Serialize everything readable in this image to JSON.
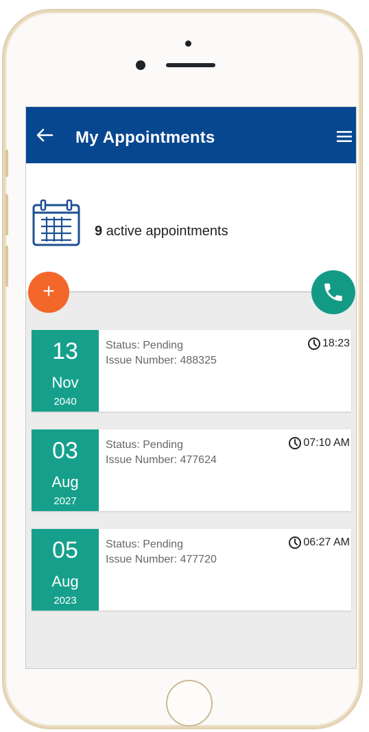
{
  "header": {
    "title": "My Appointments"
  },
  "summary": {
    "count": "9",
    "text": "active appointments"
  },
  "actions": {
    "add_label": "+"
  },
  "appointments": [
    {
      "day": "13",
      "month": "Nov",
      "year": "2040",
      "status": "Status: Pending",
      "issue": "Issue Number: 488325",
      "time": "18:23"
    },
    {
      "day": "03",
      "month": "Aug",
      "year": "2027",
      "status": "Status: Pending",
      "issue": "Issue Number: 477624",
      "time": "07:10 AM"
    },
    {
      "day": "05",
      "month": "Aug",
      "year": "2023",
      "status": "Status: Pending",
      "issue": "Issue Number: 477720",
      "time": "06:27 AM"
    }
  ],
  "icons": {
    "back": "arrow-left-icon",
    "menu": "hamburger-menu-icon",
    "calendar": "calendar-icon",
    "add": "plus-icon",
    "call": "phone-icon",
    "clock": "clock-icon"
  },
  "colors": {
    "app_bar": "#07478f",
    "accent_green": "#16a08b",
    "accent_orange": "#f4672a",
    "background": "#ececec"
  }
}
